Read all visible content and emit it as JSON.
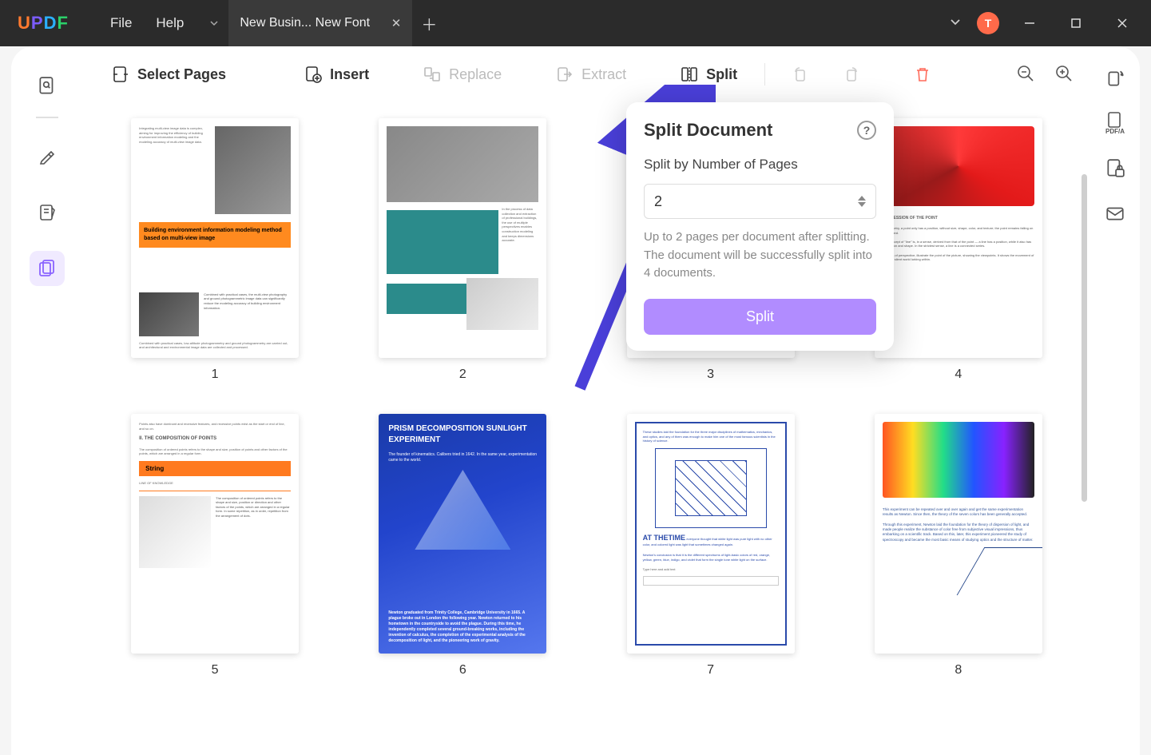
{
  "titlebar": {
    "logo": "UPDF",
    "menu": {
      "file": "File",
      "help": "Help"
    },
    "tab": {
      "title": "New Busin... New Font"
    },
    "avatar": "T"
  },
  "toolbar": {
    "select_pages": "Select Pages",
    "insert": "Insert",
    "replace": "Replace",
    "extract": "Extract",
    "split": "Split"
  },
  "left_rail": {
    "items": [
      "search-icon",
      "highlighter-icon",
      "notes-icon",
      "organize-pages-icon"
    ]
  },
  "right_rail": {
    "items": [
      "rotate-icon",
      "pdfa-icon",
      "lock-icon",
      "mail-icon"
    ],
    "pdfa_label": "PDF/A"
  },
  "pages": [
    {
      "num": "1"
    },
    {
      "num": "2"
    },
    {
      "num": "3"
    },
    {
      "num": "4"
    },
    {
      "num": "5"
    },
    {
      "num": "6"
    },
    {
      "num": "7"
    },
    {
      "num": "8"
    }
  ],
  "thumbs": {
    "p1": {
      "banner": "Building environment information modeling method based on multi-view image"
    },
    "p5": {
      "composition": "II. THE COMPOSITION OF POINTS",
      "string": "String",
      "knowledge": "LINE OF KNOWLEDGE"
    },
    "p6": {
      "title": "PRISM DECOMPOSITION SUNLIGHT EXPERIMENT"
    },
    "p7": {
      "heading": "AT THETIME"
    }
  },
  "popover": {
    "title": "Split Document",
    "subtitle": "Split by Number of Pages",
    "value": "2",
    "description": "Up to 2 pages per document after splitting. The document will be successfully split into 4 documents.",
    "action": "Split"
  }
}
